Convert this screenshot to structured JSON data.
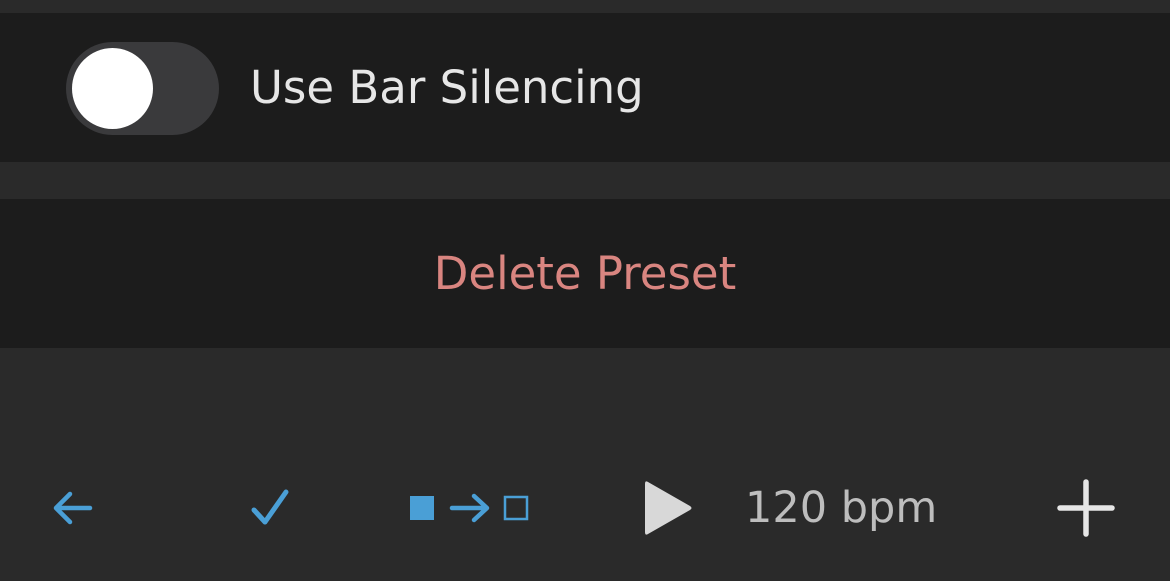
{
  "settings": {
    "bar_silencing": {
      "label": "Use Bar Silencing",
      "enabled": false
    },
    "delete_preset_label": "Delete Preset"
  },
  "toolbar": {
    "back_icon": "arrow-left-icon",
    "confirm_icon": "checkmark-icon",
    "bar_transition_icon": "filled-square-arrow-empty-square-icon",
    "play_icon": "play-icon",
    "tempo_label": "120 bpm",
    "add_icon": "plus-icon"
  },
  "colors": {
    "accent_blue": "#4a9fd6",
    "delete_red": "#d98580",
    "row_background": "#1c1c1c",
    "page_background": "#2a2a2a"
  }
}
